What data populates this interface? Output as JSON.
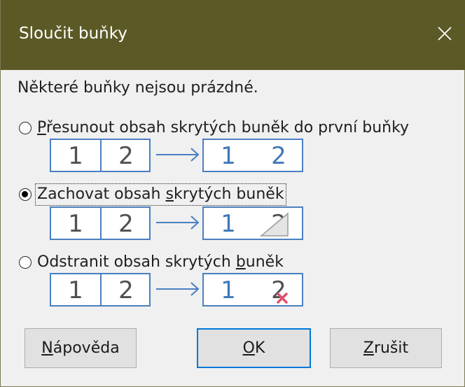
{
  "dialog": {
    "title": "Sloučit buňky",
    "prompt": "Některé buňky nejsou prázdné."
  },
  "options": [
    {
      "label": "Přesunout obsah skrytých buněk do první buňky",
      "accel": "P",
      "rest": "řesunout obsah skrytých buněk do první buňky",
      "checked": false
    },
    {
      "label": "Zachovat obsah skrytých buněk",
      "pre": "Zachovat obsah ",
      "accel": "s",
      "rest": "krytých buněk",
      "checked": true
    },
    {
      "label": "Odstranit obsah skrytých buněk",
      "pre": "Odstranit obsah skrytých ",
      "accel": "b",
      "rest": "uněk",
      "checked": false
    }
  ],
  "illustrations": {
    "cell1": "1",
    "cell2": "2",
    "merged1": "1",
    "merged2": "2"
  },
  "buttons": {
    "help": {
      "accel": "N",
      "rest": "ápověda"
    },
    "ok": {
      "accel": "O",
      "rest": "K"
    },
    "cancel": {
      "accel": "Z",
      "rest": "rušit"
    }
  },
  "colors": {
    "titlebar": "#5b5a26",
    "cell_border": "#4a7fc1",
    "cell_number_dark": "#505050",
    "cell_number_blue": "#3f78b8",
    "delete_mark": "#e0526a",
    "default_button_border": "#0078d7"
  }
}
